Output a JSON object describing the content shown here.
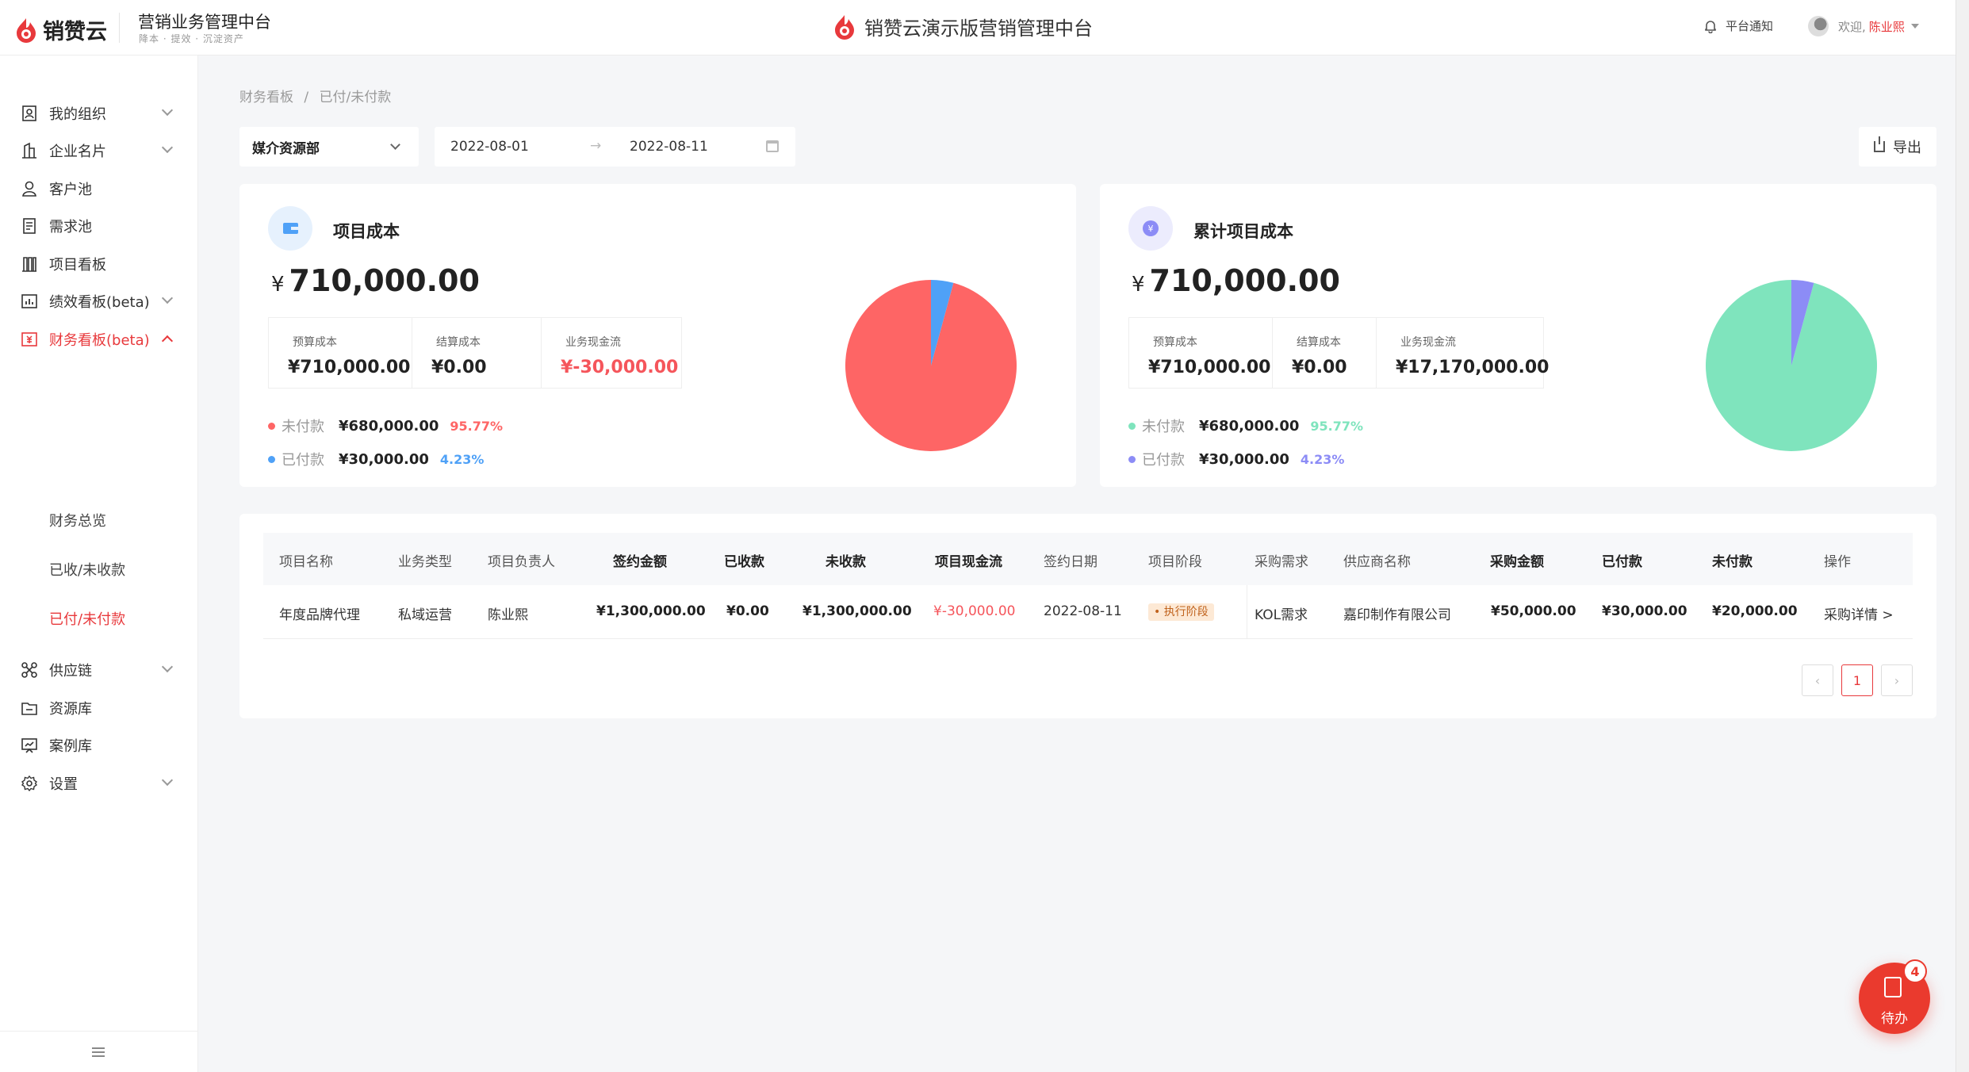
{
  "header": {
    "logo_text": "销赞云",
    "title": "营销业务管理中台",
    "subtitle": "降本 · 提效 · 沉淀资产",
    "center_title": "销赞云演示版营销管理中台",
    "notify_label": "平台通知",
    "welcome": "欢迎,",
    "user_name": "陈业熙"
  },
  "sidebar": {
    "items": [
      {
        "label": "我的组织",
        "icon": "org-icon"
      },
      {
        "label": "企业名片",
        "icon": "building-icon"
      },
      {
        "label": "客户池",
        "icon": "user-icon"
      },
      {
        "label": "需求池",
        "icon": "list-icon"
      },
      {
        "label": "项目看板",
        "icon": "board-icon"
      },
      {
        "label": "绩效看板(beta)",
        "icon": "chart-icon"
      },
      {
        "label": "财务看板(beta)",
        "icon": "finance-icon"
      },
      {
        "label": "供应链",
        "icon": "supply-icon"
      },
      {
        "label": "资源库",
        "icon": "folder-icon"
      },
      {
        "label": "案例库",
        "icon": "presentation-icon"
      },
      {
        "label": "设置",
        "icon": "gear-icon"
      }
    ],
    "finance_sub": [
      "财务总览",
      "已收/未收款",
      "已付/未付款"
    ]
  },
  "breadcrumb": {
    "root": "财务看板",
    "sep": "/",
    "current": "已付/未付款"
  },
  "filters": {
    "department": "媒介资源部",
    "date_start": "2022-08-01",
    "date_arrow": "→",
    "date_end": "2022-08-11",
    "export_label": "导出"
  },
  "card_left": {
    "title": "项目成本",
    "currency": "¥",
    "total": "710,000.00",
    "stats": [
      {
        "label": "预算成本",
        "value": "¥710,000.00"
      },
      {
        "label": "结算成本",
        "value": "¥0.00"
      },
      {
        "label": "业务现金流",
        "value": "¥-30,000.00"
      }
    ],
    "legend": [
      {
        "label": "未付款",
        "amount": "¥680,000.00",
        "pct": "95.77%"
      },
      {
        "label": "已付款",
        "amount": "¥30,000.00",
        "pct": "4.23%"
      }
    ]
  },
  "card_right": {
    "title": "累计项目成本",
    "currency": "¥",
    "total": "710,000.00",
    "stats": [
      {
        "label": "预算成本",
        "value": "¥710,000.00"
      },
      {
        "label": "结算成本",
        "value": "¥0.00"
      },
      {
        "label": "业务现金流",
        "value": "¥17,170,000.00"
      }
    ],
    "legend": [
      {
        "label": "未付款",
        "amount": "¥680,000.00",
        "pct": "95.77%"
      },
      {
        "label": "已付款",
        "amount": "¥30,000.00",
        "pct": "4.23%"
      }
    ]
  },
  "chart_data": [
    {
      "type": "pie",
      "categories": [
        "未付款",
        "已付款"
      ],
      "values": [
        95.77,
        4.23
      ],
      "colors": [
        "#fe6565",
        "#4fa1f7"
      ]
    },
    {
      "type": "pie",
      "categories": [
        "未付款",
        "已付款"
      ],
      "values": [
        95.77,
        4.23
      ],
      "colors": [
        "#7fe4bd",
        "#8c8cf6"
      ]
    }
  ],
  "table": {
    "headers": [
      "项目名称",
      "业务类型",
      "项目负责人",
      "签约金额",
      "已收款",
      "未收款",
      "项目现金流",
      "签约日期",
      "项目阶段",
      "采购需求",
      "供应商名称",
      "采购金额",
      "已付款",
      "未付款",
      "操作"
    ],
    "row": {
      "name": "年度品牌代理",
      "biz_type": "私域运营",
      "owner": "陈业熙",
      "contract_amt": "¥1,300,000.00",
      "received": "¥0.00",
      "unreceived": "¥1,300,000.00",
      "cashflow": "¥-30,000.00",
      "sign_date": "2022-08-11",
      "stage": "• 执行阶段",
      "purchase_need": "KOL需求",
      "supplier": "嘉印制作有限公司",
      "purchase_amt": "¥50,000.00",
      "paid": "¥30,000.00",
      "unpaid": "¥20,000.00",
      "action": "采购详情  >"
    },
    "page": "1"
  },
  "todo": {
    "label": "待办",
    "count": "4"
  },
  "colors": {
    "accent": "#e8393c",
    "unpaid_red": "#fe6565",
    "paid_blue": "#4fa1f7",
    "unpaid_green": "#7fe4bd",
    "paid_purple": "#8c8cf6"
  }
}
